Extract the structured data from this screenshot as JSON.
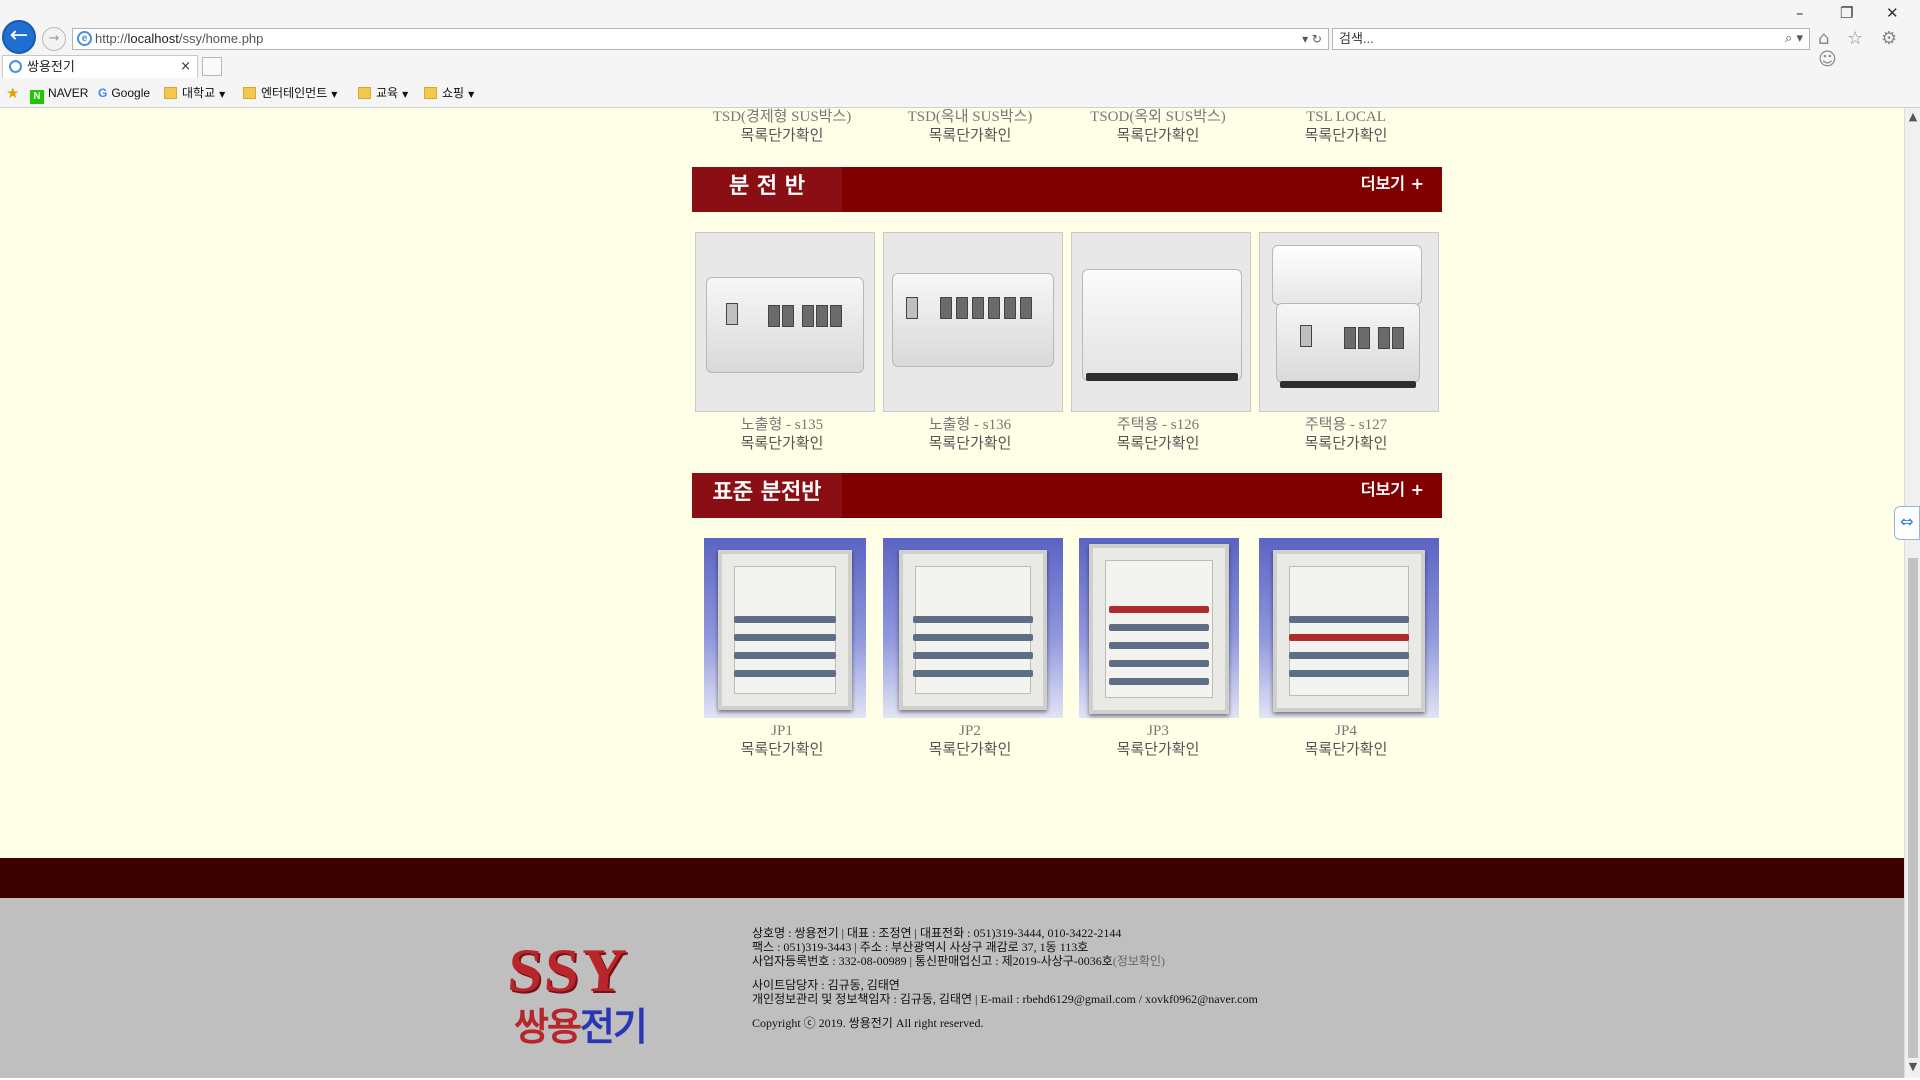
{
  "browser": {
    "url_prefix": "http://",
    "url_host": "localhost",
    "url_path": "/ssy/home.php",
    "url_tools": "▾ ↻",
    "search_placeholder": "검색...",
    "search_tools": "⌕ ▾",
    "tab_title": "쌍용전기",
    "tab_close": "×",
    "toolbar_icons": "⌂ ☆ ⚙ ☺",
    "window_controls": {
      "minimize": "–",
      "restore": "❐",
      "close": "✕"
    },
    "favorites": [
      {
        "label": "NAVER"
      },
      {
        "label": "Google"
      },
      {
        "label": "대학교"
      },
      {
        "label": "엔터테인먼트"
      },
      {
        "label": "교육"
      },
      {
        "label": "쇼핑"
      }
    ]
  },
  "page": {
    "top_products": [
      {
        "name": "TSD(경제형 SUS박스)",
        "link": "목록단가확인"
      },
      {
        "name": "TSD(옥내 SUS박스)",
        "link": "목록단가확인"
      },
      {
        "name": "TSOD(옥외 SUS박스)",
        "link": "목록단가확인"
      },
      {
        "name": "TSL LOCAL",
        "link": "목록단가확인"
      }
    ],
    "categories": [
      {
        "title": "분 전 반",
        "more": "더보기 +",
        "products": [
          {
            "name": "노출형 - s135",
            "link": "목록단가확인"
          },
          {
            "name": "노출형 - s136",
            "link": "목록단가확인"
          },
          {
            "name": "주택용 - s126",
            "link": "목록단가확인"
          },
          {
            "name": "주택용 - s127",
            "link": "목록단가확인"
          }
        ]
      },
      {
        "title": "표준 분전반",
        "more": "더보기 +",
        "products": [
          {
            "name": "JP1",
            "link": "목록단가확인"
          },
          {
            "name": "JP2",
            "link": "목록단가확인"
          },
          {
            "name": "JP3",
            "link": "목록단가확인"
          },
          {
            "name": "JP4",
            "link": "목록단가확인"
          }
        ]
      }
    ]
  },
  "footer": {
    "logo_top": "SSY",
    "logo_red": "쌍용",
    "logo_blue": "전기",
    "line1": "상호명 : 쌍용전기  |  대표 : 조정연  |  대표전화 : 051)319-3444, 010-3422-2144",
    "line2": "팩스 : 051)319-3443  |  주소 : 부산광역시 사상구 괘감로 37, 1동 113호",
    "line3": "사업자등록번호 : 332-08-00989   |   통신판매업신고 : 제2019-사상구-0036호",
    "line3_link": "(정보확인)",
    "line4": "사이트담당자 : 김규동, 김태연",
    "line5": "개인정보관리 및 정보책임자 : 김규동, 김태연  |   E-mail : rbehd6129@gmail.com / xovkf0962@naver.com",
    "copyright": "Copyright ⓒ 2019. 쌍용전기 All right reserved."
  }
}
